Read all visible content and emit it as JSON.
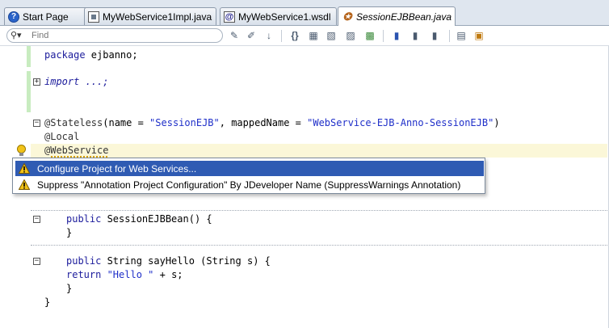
{
  "tabs": [
    {
      "label": "Start Page",
      "icon": "help-icon"
    },
    {
      "label": "MyWebService1Impl.java",
      "icon": "java-file-icon"
    },
    {
      "label": "MyWebService1.wsdl",
      "icon": "wsdl-file-icon"
    },
    {
      "label": "SessionEJBBean.java",
      "icon": "bean-file-icon",
      "active": true
    }
  ],
  "toolbar": {
    "search_placeholder": "Find"
  },
  "code": {
    "l1_kw": "package",
    "l1_rest": " ejbanno;",
    "l2": "import ...;",
    "l3_ann": "@Stateless",
    "l3_a": "(name = ",
    "l3_s1": "\"SessionEJB\"",
    "l3_b": ", mappedName = ",
    "l3_s2": "\"WebService-EJB-Anno-SessionEJB\"",
    "l3_c": ")",
    "l4": "@Local",
    "l5_at": "@",
    "l5_name": "WebService",
    "l6_kw": "public",
    "l6_rest": " SessionEJBBean() {",
    "l7": "}",
    "l8_kw": "public",
    "l8_rest": " String sayHello (String s) {",
    "l9_kw": "return",
    "l9_s": " \"Hello \"",
    "l9_rest": " + s;",
    "l10": "}",
    "l11": "}"
  },
  "popup": {
    "items": [
      {
        "label": "Configure Project for Web Services...",
        "selected": true,
        "icon": "warning-icon"
      },
      {
        "label": "Suppress \"Annotation Project Configuration\" By JDeveloper Name (SuppressWarnings Annotation)",
        "selected": false,
        "icon": "warning-icon"
      }
    ]
  },
  "colors": {
    "keyword": "#1c1c9c",
    "string": "#1f2fc9",
    "selection": "#2f5bb3",
    "current_line": "#fbf7d8"
  }
}
